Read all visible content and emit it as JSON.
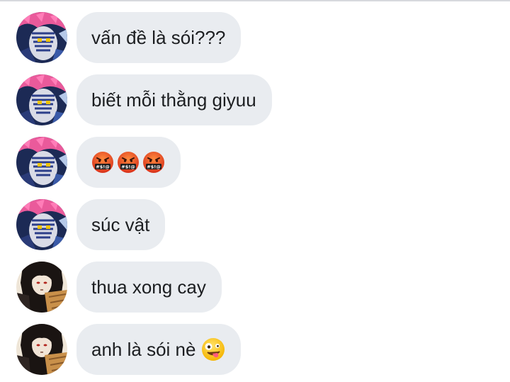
{
  "messages": [
    {
      "avatar": "akaza-avatar",
      "text": "vấn đề là sói???"
    },
    {
      "avatar": "akaza-avatar",
      "text": "biết mỗi thằng giyuu"
    },
    {
      "avatar": "akaza-avatar",
      "text": "",
      "emojis": [
        "cursing-face-emoji",
        "cursing-face-emoji",
        "cursing-face-emoji"
      ]
    },
    {
      "avatar": "akaza-avatar",
      "text": "súc vật"
    },
    {
      "avatar": "kokushibo-avatar",
      "text": "thua xong cay"
    },
    {
      "avatar": "kokushibo-avatar",
      "text": "anh là sói nè",
      "trailing_emoji": "zany-face-emoji"
    }
  ],
  "colors": {
    "bubble": "#e9ecf0",
    "text": "#1c1e21",
    "divider": "#d7d9dd"
  }
}
